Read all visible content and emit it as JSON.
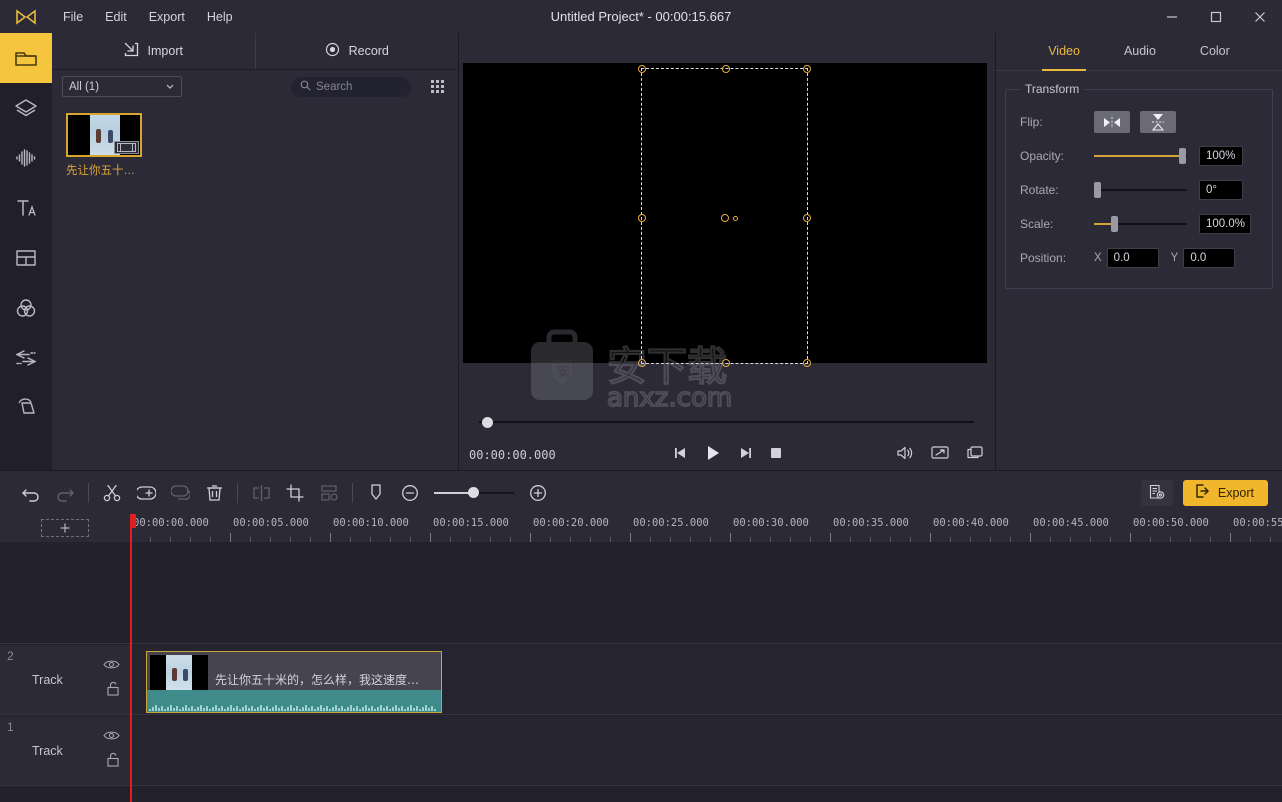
{
  "window": {
    "title": "Untitled Project* - 00:00:15.667",
    "minimize": "—",
    "maximize": "□",
    "close": "✕"
  },
  "menubar": {
    "items": [
      {
        "label": "File"
      },
      {
        "label": "Edit"
      },
      {
        "label": "Export"
      },
      {
        "label": "Help"
      }
    ]
  },
  "sidebar": {
    "items": [
      {
        "name": "media",
        "icon": "folder-icon"
      },
      {
        "name": "stickers",
        "icon": "layers-icon"
      },
      {
        "name": "audio",
        "icon": "waveform-icon"
      },
      {
        "name": "text",
        "icon": "text-icon"
      },
      {
        "name": "template",
        "icon": "split-screen-icon"
      },
      {
        "name": "color",
        "icon": "color-circles-icon"
      },
      {
        "name": "transition",
        "icon": "transition-icon"
      },
      {
        "name": "filter",
        "icon": "filter-icon"
      }
    ]
  },
  "media_panel": {
    "tabs": [
      {
        "label": "Import",
        "icon": "import-icon"
      },
      {
        "label": "Record",
        "icon": "record-icon"
      }
    ],
    "filter_value": "All (1)",
    "search_placeholder": "Search",
    "grid_icon": "grid-view-icon",
    "items": [
      {
        "name": "先让你五十…",
        "badge": "film-icon"
      }
    ]
  },
  "preview": {
    "watermark_cn": "安下载",
    "watermark_en": "anxz.com",
    "timecode": "00:00:00.000",
    "controls": {
      "prev_frame": "prev-frame-icon",
      "play": "play-icon",
      "next_frame": "next-frame-icon",
      "stop": "stop-icon",
      "volume": "volume-icon",
      "fullscreen": "fullscreen-icon",
      "snapshot": "snapshot-icon"
    }
  },
  "properties": {
    "tabs": [
      {
        "label": "Video",
        "active": true
      },
      {
        "label": "Audio",
        "active": false
      },
      {
        "label": "Color",
        "active": false
      }
    ],
    "group_title": "Transform",
    "rows": {
      "flip_label": "Flip:",
      "flip_horizontal_icon": "flip-horizontal-icon",
      "flip_vertical_icon": "flip-vertical-icon",
      "opacity_label": "Opacity:",
      "opacity_value": "100%",
      "opacity_pct": 95,
      "rotate_label": "Rotate:",
      "rotate_value": "0°",
      "rotate_pct": 0,
      "scale_label": "Scale:",
      "scale_value": "100.0%",
      "scale_pct": 22,
      "position_label": "Position:",
      "position_x_label": "X",
      "position_x_value": "0.0",
      "position_y_label": "Y",
      "position_y_value": "0.0"
    }
  },
  "toolbar": {
    "icons": [
      {
        "name": "undo-icon",
        "dim": false
      },
      {
        "name": "redo-icon",
        "dim": true
      },
      {
        "name": "cut-icon",
        "dim": false
      },
      {
        "name": "add-to-timeline-icon",
        "dim": false
      },
      {
        "name": "duplicate-icon",
        "dim": true
      },
      {
        "name": "delete-icon",
        "dim": false
      },
      {
        "name": "split-icon",
        "dim": true
      },
      {
        "name": "crop-icon",
        "dim": false
      },
      {
        "name": "ungroup-icon",
        "dim": true
      },
      {
        "name": "marker-icon",
        "dim": false
      }
    ],
    "zoom_out_icon": "zoom-out-icon",
    "zoom_in_icon": "zoom-in-icon",
    "settings_icon": "project-settings-icon",
    "export_label": "Export",
    "export_icon": "export-icon",
    "export_color": "#f0b62c"
  },
  "timeline": {
    "add_track_label": "+",
    "ruler_labels": [
      "00:00:00.000",
      "00:00:05.000",
      "00:00:10.000",
      "00:00:15.000",
      "00:00:20.000",
      "00:00:25.000",
      "00:00:30.000",
      "00:00:35.000",
      "00:00:40.000",
      "00:00:45.000",
      "00:00:50.000",
      "00:00:55"
    ],
    "tracks": [
      {
        "number": "2",
        "label": "Track",
        "visible_icon": "eye-icon",
        "lock_icon": "unlock-icon"
      },
      {
        "number": "1",
        "label": "Track",
        "visible_icon": "eye-icon",
        "lock_icon": "unlock-icon"
      }
    ],
    "clip": {
      "title": "先让你五十米的，怎么样，我这速度…",
      "selected": true,
      "accent": "#c8a63c",
      "audio_color": "#3f8b8b"
    },
    "playhead_position": "00:00:00.000"
  }
}
